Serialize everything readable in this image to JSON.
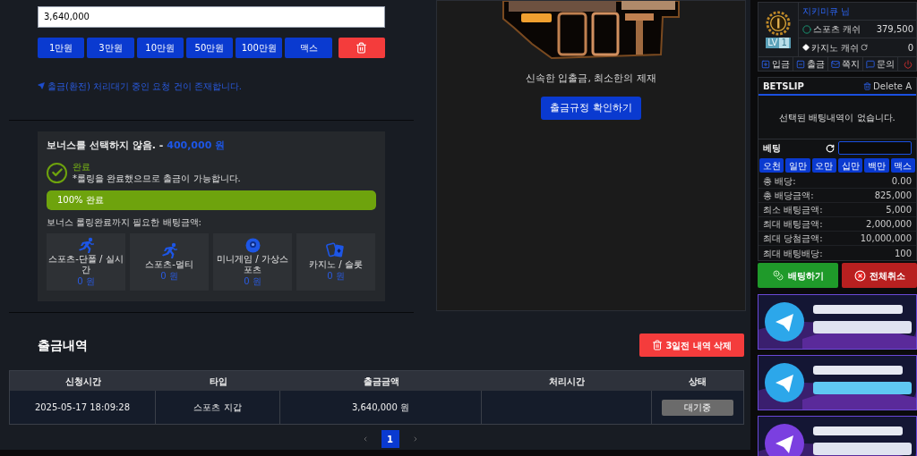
{
  "withdraw_form": {
    "amount_field": {
      "value": "3,640,000"
    },
    "quick_amounts": [
      "1만원",
      "3만원",
      "10만원",
      "50만원",
      "100만원",
      "맥스"
    ],
    "notice": "출금(환전) 처리대기 중인 요청 건이 존재합니다."
  },
  "bonus": {
    "title": "보너스를 선택하지 않음. -",
    "amount": "400,000 원",
    "status_label": "완료",
    "status_text": "*롤링을 완료했으므로 출금이 가능합니다.",
    "progress": {
      "level": 1,
      "label": "100% 완료"
    },
    "required_label": "보너스 롤링완료까지 필요한 배팅금액:",
    "categories": [
      {
        "kind": "runner",
        "label": "스포츠-단폴 / 실시간",
        "amount": "0 원"
      },
      {
        "kind": "runner",
        "label": "스포츠-멀티",
        "amount": "0 원"
      },
      {
        "kind": "ball",
        "label": "미니게임 / 가상스포츠",
        "amount": "0 원"
      },
      {
        "kind": "cards",
        "label": "카지노 / 슬롯",
        "amount": "0 원"
      }
    ]
  },
  "promo": {
    "tagline": "신속한 입출금, 최소한의 제재",
    "button": "출금규정 확인하기"
  },
  "history": {
    "title": "출금내역",
    "delete_button": "3일전 내역 삭제",
    "columns": [
      "신청시간",
      "타입",
      "출금금액",
      "처리시간",
      "상태"
    ],
    "rows": [
      {
        "cells": [
          "2025-05-17 18:09:28",
          "스포츠 지갑",
          "3,640,000 원",
          ""
        ],
        "status": "대기중"
      }
    ],
    "pages": [
      {
        "label": "1",
        "selected": true
      }
    ]
  },
  "sidebar": {
    "user": {
      "name": "지키미큐 님",
      "level_prefix": "LV",
      "level": "1"
    },
    "balances": [
      {
        "kind": "sports",
        "label": "스포츠 캐쉬",
        "amount": "379,500"
      },
      {
        "kind": "casino",
        "label": "카지노 캐쉬",
        "amount": "0"
      }
    ],
    "menu": [
      {
        "kind": "plus",
        "label": "입금"
      },
      {
        "kind": "minus",
        "label": "출금"
      },
      {
        "kind": "mail",
        "label": "쪽지"
      },
      {
        "kind": "chat",
        "label": "문의"
      }
    ],
    "betslip": {
      "title": "BETSLIP",
      "delete": "Delete A",
      "empty": "선택된 배팅내역이 없습니다.",
      "bet_label": "베팅",
      "amount_buttons": [
        "오천",
        "일만",
        "오만",
        "십만",
        "백만",
        "맥스"
      ],
      "summary": [
        {
          "label": "총 배당:",
          "value": "0.00"
        },
        {
          "label": "총 배당금액:",
          "value": "825,000"
        },
        {
          "label": "최소 배팅금액:",
          "value": "5,000"
        },
        {
          "label": "최대 배팅금액:",
          "value": "2,000,000"
        },
        {
          "label": "최대 당첨금액:",
          "value": "10,000,000"
        },
        {
          "label": "최대 배팅배당:",
          "value": "100"
        }
      ],
      "place_button": "배팅하기",
      "cancel_button": "전체취소"
    }
  }
}
